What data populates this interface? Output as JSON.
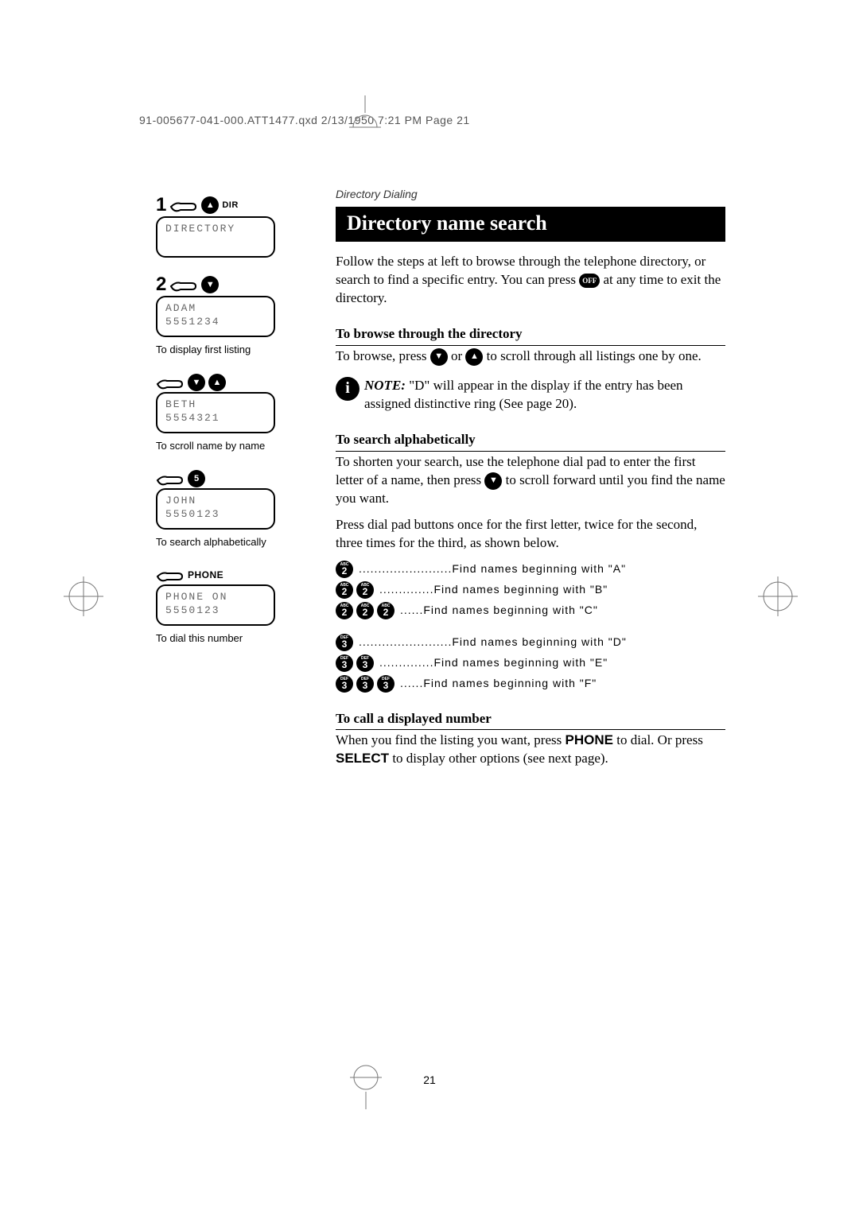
{
  "header_line": "91-005677-041-000.ATT1477.qxd  2/13/1950  7:21 PM  Page 21",
  "left": {
    "step1_num": "1",
    "dir": "DIR",
    "lcd1_line1": "DIRECTORY",
    "step2_num": "2",
    "lcd2_line1": "ADAM",
    "lcd2_line2": "5551234",
    "caption_first": "To display first listing",
    "lcd3_line1": "BETH",
    "lcd3_line2": "5554321",
    "caption_scroll": "To scroll name by name",
    "key5": "5",
    "lcd4_line1": "JOHN",
    "lcd4_line2": "5550123",
    "caption_alpha": "To search alphabetically",
    "phone_label": "PHONE",
    "lcd5_line1": "PHONE ON",
    "lcd5_line2": "5550123",
    "caption_dial": "To dial this number"
  },
  "right": {
    "breadcrumb": "Directory Dialing",
    "title": "Directory name search",
    "intro_a": "Follow the steps at left to browse through the tele­phone directory, or search to find a specific entry. You can press ",
    "off_label": "OFF",
    "intro_b": " at any time to exit the directory.",
    "h_browse": "To browse through the directory",
    "browse_a": "To browse, press ",
    "browse_b": " or ",
    "browse_c": " to scroll through all listings one by one.",
    "note_label": "NOTE:",
    "note_text": "  \"D\" will appear in the display if the entry has been assigned distinctive ring (See page 20).",
    "h_alpha": "To search alphabetically",
    "alpha_p1_a": "To shorten your search, use the telephone dial pad to enter the first letter of a name, then press ",
    "alpha_p1_b": " to scroll forward until you find the name you want.",
    "alpha_p2": "Press dial pad buttons once for the first letter, twice for the second, three times for the third, as shown below.",
    "kp": {
      "k2_tiny": "ABC",
      "k2_num": "2",
      "k3_tiny": "DEF",
      "k3_num": "3",
      "rA": "........................Find names beginning with \"A\"",
      "rB": "..............Find names beginning with \"B\"",
      "rC": "......Find names beginning with \"C\"",
      "rD": "........................Find names beginning with \"D\"",
      "rE": "..............Find names beginning with \"E\"",
      "rF": "......Find names beginning with \"F\""
    },
    "h_call": "To call a displayed number",
    "call_a": "When you find the listing you want, press ",
    "phone_btn": "PHONE",
    "call_b": " to dial. Or press ",
    "select_btn": "SELECT",
    "call_c": " to display other options (see next page)."
  },
  "page_num": "21"
}
